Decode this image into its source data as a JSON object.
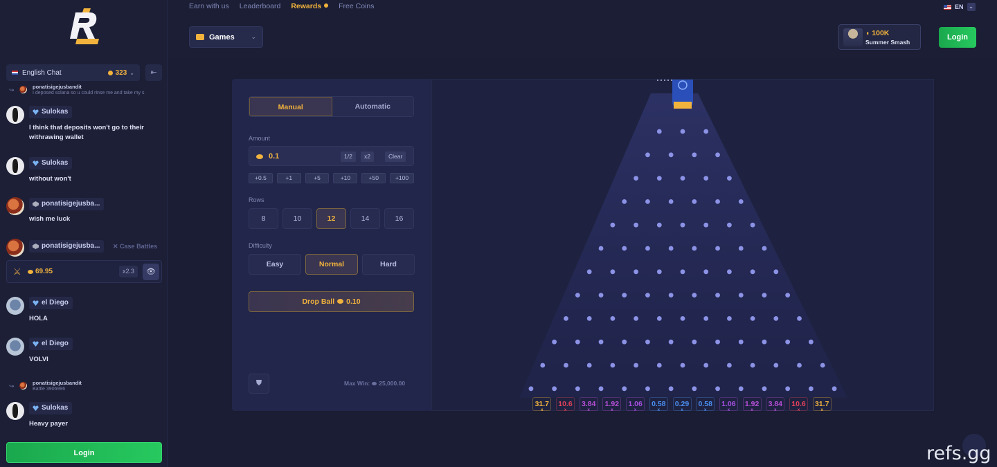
{
  "nav": {
    "links": [
      "Earn with us",
      "Leaderboard",
      "Rewards",
      "Free Coins"
    ],
    "language": "EN"
  },
  "header": {
    "games_label": "Games",
    "promo_amount": "100K",
    "promo_title": "Summer Smash",
    "login_label": "Login"
  },
  "chat": {
    "room_label": "English Chat",
    "online_count": "323",
    "collapse_icon": "collapse-left-icon",
    "reply1": {
      "name": "ponatisigejusbandit",
      "text": "I deposed solana so u could rinse me and take my s"
    },
    "messages": [
      {
        "user": "Sulokas",
        "text": "I think that deposits won't go to their withrawing wallet"
      },
      {
        "user": "Sulokas",
        "text": "without won't"
      },
      {
        "user": "ponatisigejusba...",
        "text": "wish me luck"
      },
      {
        "user": "ponatisigejusba...",
        "text": ""
      },
      {
        "user": "el Diego",
        "text": "HOLA"
      },
      {
        "user": "el Diego",
        "text": "VOLVI"
      },
      {
        "user": "Sulokas",
        "text": "Heavy payer"
      }
    ],
    "case_battle": {
      "label": "Case Battles",
      "value": "69.95",
      "multiplier": "x2.3"
    },
    "reply2": {
      "name": "ponatisigejusbandit",
      "text": "Battle 3906996"
    },
    "login_label": "Login"
  },
  "controls": {
    "tabs": [
      "Manual",
      "Automatic"
    ],
    "active_tab": "Manual",
    "amount_label": "Amount",
    "amount_value": "0.1",
    "amount_buttons": [
      "1/2",
      "x2",
      "Clear"
    ],
    "quick_adds": [
      "+0.5",
      "+1",
      "+5",
      "+10",
      "+50",
      "+100"
    ],
    "rows_label": "Rows",
    "row_options": [
      "8",
      "10",
      "12",
      "14",
      "16"
    ],
    "active_rows": "12",
    "difficulty_label": "Difficulty",
    "difficulty_options": [
      "Easy",
      "Normal",
      "Hard"
    ],
    "active_difficulty": "Normal",
    "drop_label": "Drop Ball",
    "drop_amount": "0.10",
    "max_win_label": "Max Win:",
    "max_win_value": "25,000.00"
  },
  "board": {
    "rows": 12,
    "multipliers": [
      "31.7",
      "10.6",
      "3.84",
      "1.92",
      "1.06",
      "0.58",
      "0.29",
      "0.58",
      "1.06",
      "1.92",
      "3.84",
      "10.6",
      "31.7"
    ],
    "multiplier_suffix": "x",
    "colors": {
      "31.7": "#f2b33d",
      "10.6": "#e0415a",
      "3.84": "#b84fd8",
      "1.92": "#b84fd8",
      "1.06": "#a64fe0",
      "0.58": "#4a8ef0",
      "0.29": "#4a8ef0"
    },
    "peg_color": "#8c93e6"
  },
  "watermark": "refs.gg"
}
